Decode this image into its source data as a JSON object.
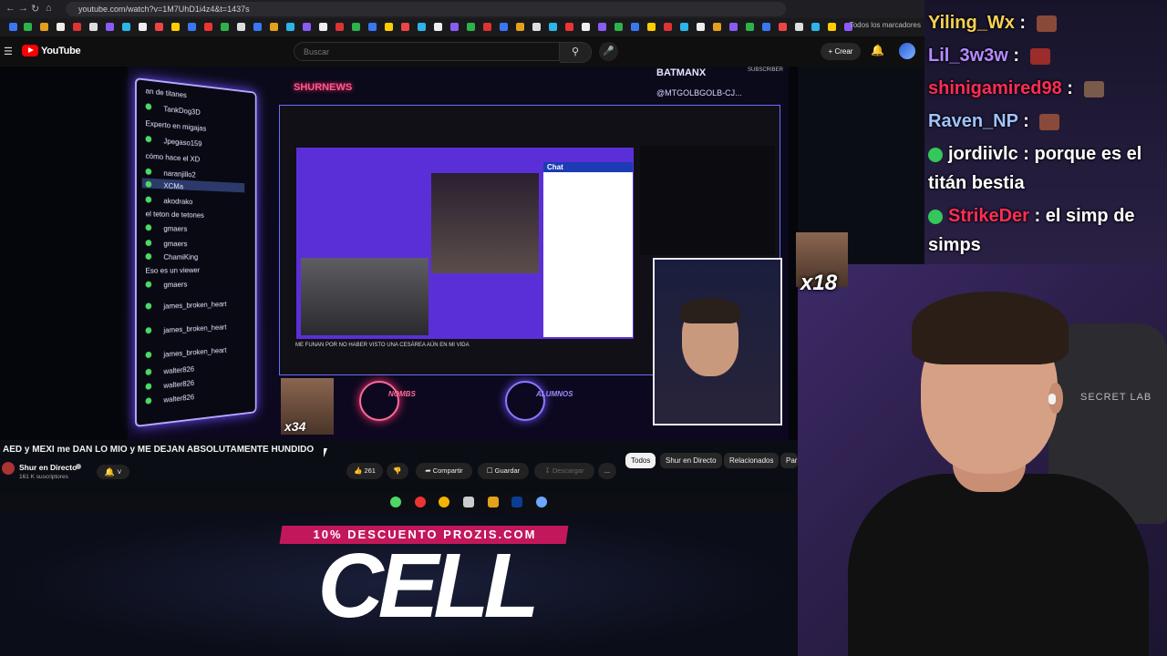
{
  "browser": {
    "url": "youtube.com/watch?v=1M7UhD1i4z4&t=1437s",
    "bookmarks_all": "Todos los marcadores"
  },
  "youtube": {
    "logo_text": "YouTube",
    "search_placeholder": "Buscar",
    "create_label": "Crear"
  },
  "video": {
    "stream_chat": [
      {
        "name": "an de titanes"
      },
      {
        "name": "TankDog3D"
      },
      {
        "name": "Experto en migajas"
      },
      {
        "name": "Jpegaso159"
      },
      {
        "name": "cómo hace el XD"
      },
      {
        "name": "naranjillo2"
      },
      {
        "name": "XCMa"
      },
      {
        "name": "akodrako"
      },
      {
        "name": "el teton de tetones"
      },
      {
        "name": "gmaers"
      },
      {
        "name": "gmaers"
      },
      {
        "name": "ChamiKing"
      },
      {
        "name": "Eso es un viewer"
      },
      {
        "name": "gmaers"
      },
      {
        "name": "james_broken_heart"
      },
      {
        "name": "james_broken_heart"
      },
      {
        "name": "james_broken_heart"
      },
      {
        "name": "walter826"
      },
      {
        "name": "walter826"
      },
      {
        "name": "walter826"
      }
    ],
    "overlay_logo": "SHURNEWS",
    "overlay_name": "BATMANX",
    "overlay_subscriber": "SUBSCRIBER",
    "overlay_handle": "@MTGOLBGOLB-CJ...",
    "inner_chat_title": "Chat",
    "inner_video_title": "ME FUNAN POR NO HABER VISTO UNA CESÁREA AÚN EN MI VIDA",
    "badge_left": "NOMBS",
    "badge_right": "ALUMNOS",
    "meme_label": "x34",
    "title": "AED y MEXI me DAN LO MIO y ME DEJAN ABSOLUTAMENTE HUNDIDO",
    "channel_name": "Shur en Directo",
    "subscribers": "161 K suscriptores",
    "likes": "261",
    "share_label": "Compartir",
    "save_label": "Guardar",
    "download_label": "Descargar",
    "more_label": "...",
    "chips": [
      "Todos",
      "Shur en Directo",
      "Relacionados",
      "Par"
    ]
  },
  "promo": {
    "banner": "10% DESCUENTO PROZIS.COM",
    "code": "CELL"
  },
  "twitch_chat": [
    {
      "user": "Yiling_Wx",
      "sep": " : ",
      "message": "",
      "color": "#f7d154"
    },
    {
      "user": "Lil_3w3w",
      "sep": " : ",
      "message": "",
      "color": "#b48cff"
    },
    {
      "user": "shinigamired98",
      "sep": " : ",
      "message": "",
      "color": "#ff2d55"
    },
    {
      "user": "Raven_NP",
      "sep": " : ",
      "message": "",
      "color": "#9fc3ff"
    },
    {
      "user": "jordiivlc",
      "sep": " : ",
      "message": "porque es el",
      "color": "#ffffff"
    },
    {
      "user": "",
      "sep": "",
      "message": "titán bestia",
      "color": "#ffffff"
    },
    {
      "user": "StrikeDer",
      "sep": " : ",
      "message": "el simp de",
      "color": "#ff2d55"
    },
    {
      "user": "",
      "sep": "",
      "message": "simps",
      "color": "#ffffff"
    }
  ],
  "overlay": {
    "sticker_label": "x18",
    "chair_brand": "SECRET LAB"
  }
}
